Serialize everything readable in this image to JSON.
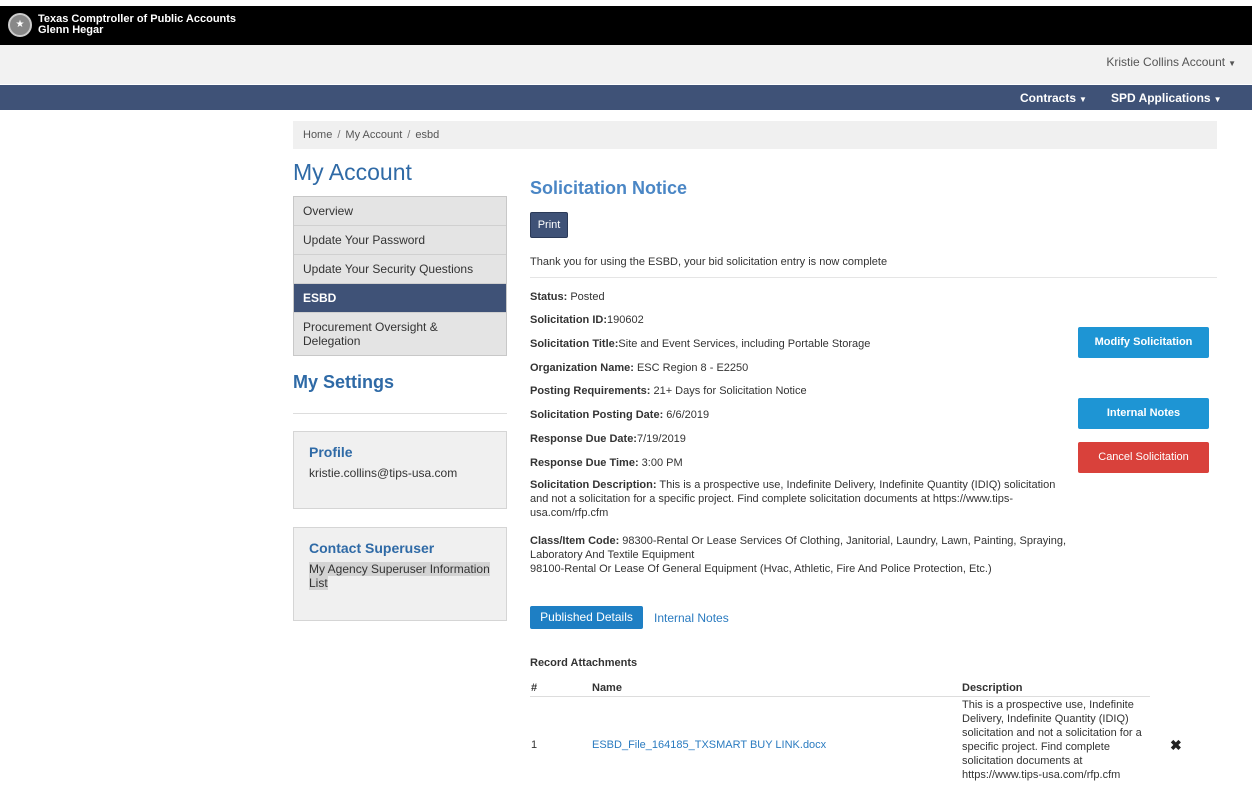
{
  "header": {
    "brand_line1": "Texas Comptroller of Public Accounts",
    "brand_line2": "Glenn Hegar",
    "seal_icon": "texas-seal-icon"
  },
  "account": {
    "label": "Kristie Collins Account"
  },
  "nav": {
    "contracts": "Contracts",
    "spd_applications": "SPD Applications"
  },
  "breadcrumb": {
    "items": [
      "Home",
      "My Account",
      "esbd"
    ]
  },
  "sidebar": {
    "title": "My Account",
    "items": [
      {
        "label": "Overview"
      },
      {
        "label": "Update Your Password"
      },
      {
        "label": "Update Your Security Questions"
      },
      {
        "label": "ESBD"
      },
      {
        "label": "Procurement Oversight & Delegation"
      }
    ],
    "active_index": 3,
    "settings_title": "My Settings",
    "profile": {
      "title": "Profile",
      "email": "kristie.collins@tips-usa.com"
    },
    "contact": {
      "title": "Contact Superuser",
      "link": "My Agency Superuser Information List"
    }
  },
  "main": {
    "title": "Solicitation Notice",
    "print_label": "Print",
    "thanks": "Thank you for using the ESBD, your bid solicitation entry is now complete",
    "fields": [
      {
        "label": "Status:",
        "value": " Posted"
      },
      {
        "label": "Solicitation ID:",
        "value": "190602"
      },
      {
        "label": "Solicitation Title:",
        "value": "Site and Event Services, including Portable Storage"
      },
      {
        "label": "Organization Name:",
        "value": " ESC Region 8 - E2250"
      },
      {
        "label": "Posting Requirements:",
        "value": " 21+ Days for Solicitation Notice"
      },
      {
        "label": "Solicitation Posting Date:",
        "value": " 6/6/2019"
      },
      {
        "label": "Response Due Date:",
        "value": "7/19/2019"
      },
      {
        "label": "Response Due Time:",
        "value": " 3:00 PM"
      },
      {
        "label": "Solicitation Description:",
        "value": " This is a prospective use, Indefinite Delivery, Indefinite Quantity (IDIQ) solicitation and not a solicitation for a specific project. Find complete solicitation documents at https://www.tips-usa.com/rfp.cfm"
      },
      {
        "label": "Class/Item Code:",
        "value": " 98300-Rental Or Lease Services Of Clothing, Janitorial, Laundry, Lawn, Painting, Spraying, Laboratory And Textile Equipment",
        "value2": "98100-Rental Or Lease Of General Equipment (Hvac, Athletic, Fire And Police Protection, Etc.)"
      }
    ],
    "buttons": {
      "modify": "Modify Solicitation",
      "internal_notes": "Internal Notes",
      "cancel": "Cancel Solicitation"
    },
    "tabs": {
      "published": "Published Details",
      "internal": "Internal Notes"
    },
    "attachments": {
      "title": "Record Attachments",
      "headers": [
        "#",
        "Name",
        "Description"
      ],
      "rows": [
        {
          "num": "1",
          "name": "ESBD_File_164185_TXSMART BUY LINK.docx",
          "description": "This is a prospective use, Indefinite Delivery, Indefinite Quantity (IDIQ) solicitation and not a solicitation for a specific project. Find complete solicitation documents at https://www.tips-usa.com/rfp.cfm"
        }
      ]
    }
  }
}
